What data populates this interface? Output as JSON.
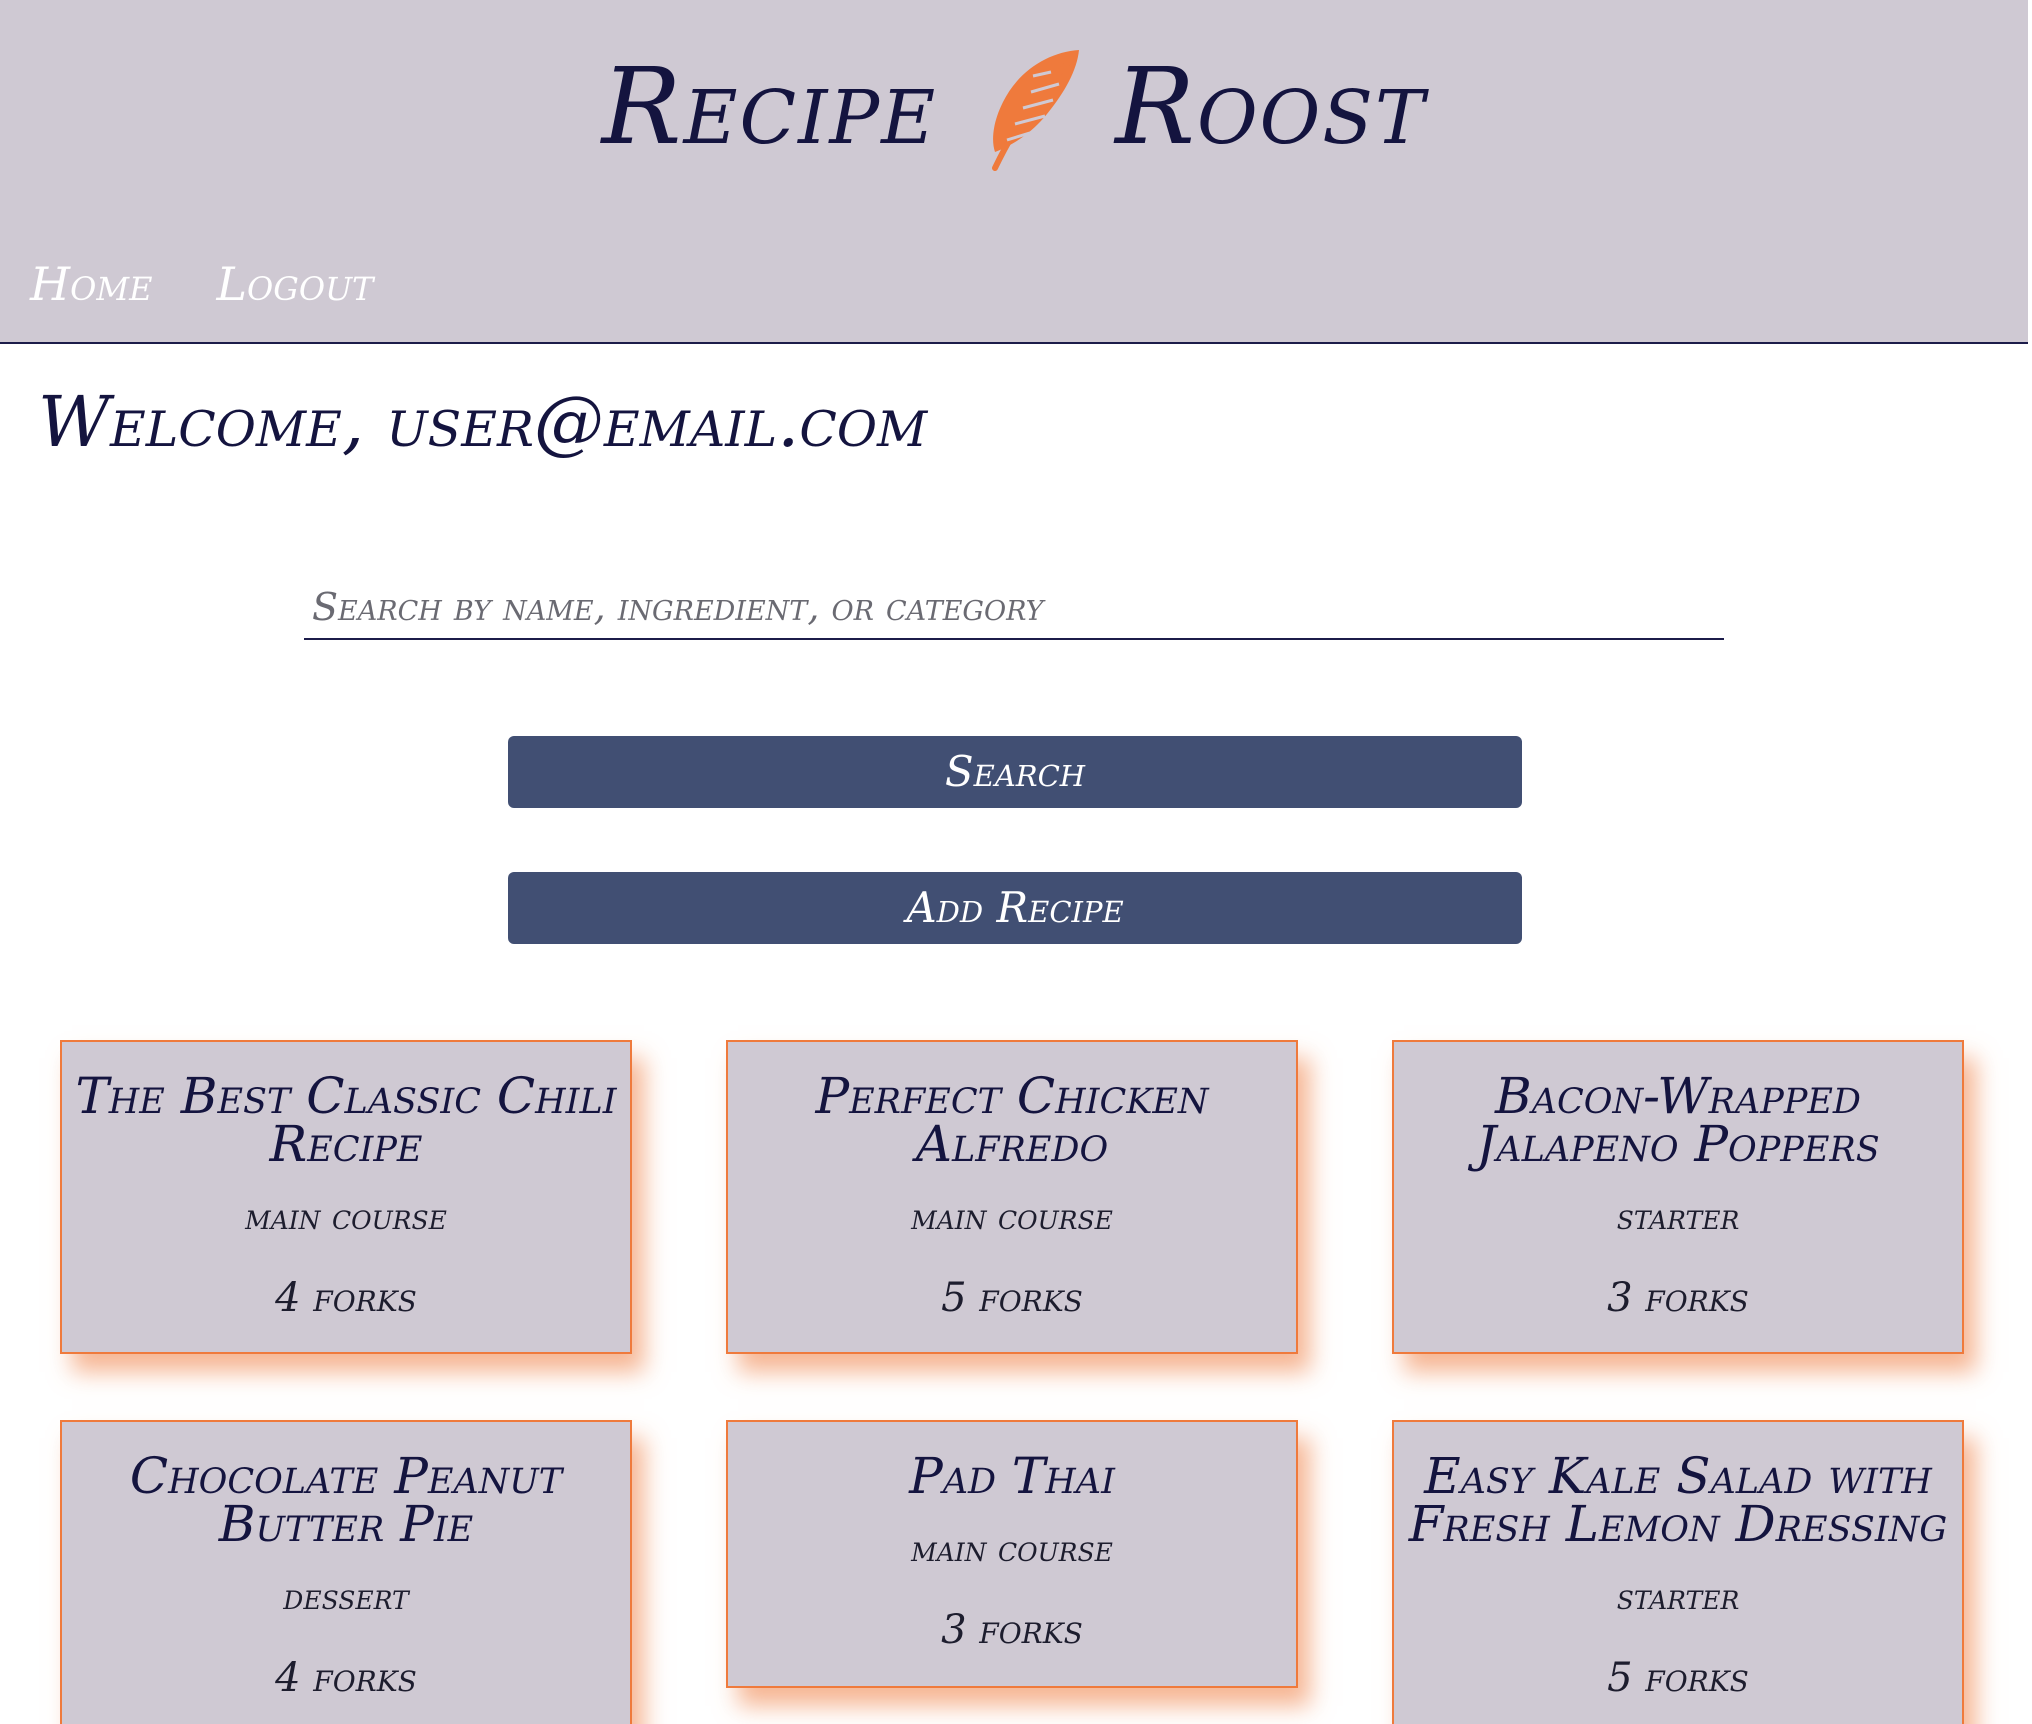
{
  "header": {
    "brand_left": "Recipe",
    "brand_right": "Roost",
    "logo_icon": "feather-icon",
    "nav": [
      {
        "label": "Home"
      },
      {
        "label": "Logout"
      }
    ]
  },
  "main": {
    "welcome": "Welcome, user@email.com",
    "search": {
      "placeholder": "Search by name, ingredient, or category",
      "value": ""
    },
    "search_button": "Search",
    "add_button": "Add Recipe"
  },
  "recipes": [
    {
      "title": "The Best Classic Chili Recipe",
      "category": "main course",
      "rating": "4 forks"
    },
    {
      "title": "Perfect Chicken Alfredo",
      "category": "main course",
      "rating": "5 forks"
    },
    {
      "title": "Bacon-Wrapped Jalapeno Poppers",
      "category": "starter",
      "rating": "3 forks"
    },
    {
      "title": "Chocolate Peanut Butter Pie",
      "category": "dessert",
      "rating": "4 forks"
    },
    {
      "title": "Pad Thai",
      "category": "main course",
      "rating": "3 forks"
    },
    {
      "title": "Easy Kale Salad with Fresh Lemon Dressing",
      "category": "starter",
      "rating": "5 forks"
    }
  ],
  "colors": {
    "header_bg": "#cfc9d3",
    "ink": "#14143f",
    "accent": "#ef7a3c",
    "button": "#414f73"
  }
}
